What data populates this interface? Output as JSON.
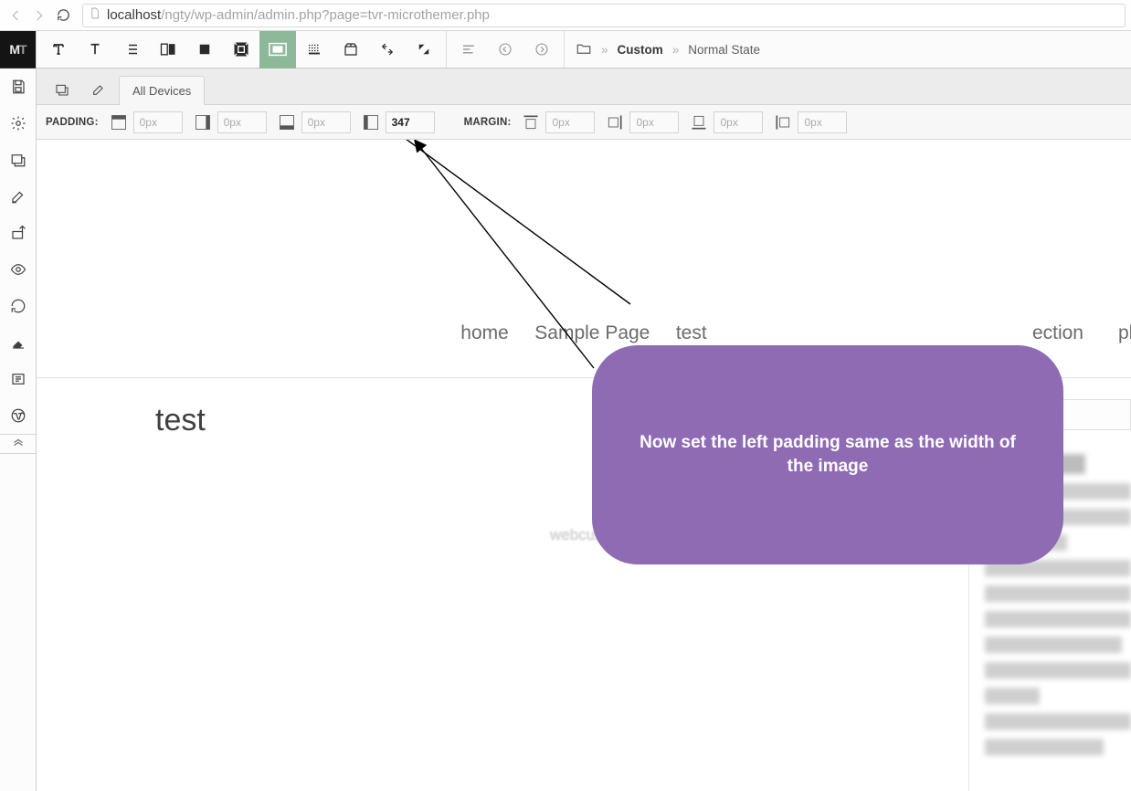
{
  "browser": {
    "url_host": "localhost",
    "url_path": "/ngty/wp-admin/admin.php?page=tvr-microthemer.php"
  },
  "logo": "MT",
  "breadcrumb": {
    "crumb1": "Custom",
    "crumb2": "Normal State"
  },
  "tabs": {
    "all_devices": "All Devices"
  },
  "spacing": {
    "padding_label": "PADDING:",
    "margin_label": "MARGIN:",
    "placeholder": "0px",
    "padding_left_value": "347"
  },
  "preview": {
    "nav": {
      "home": "home",
      "sample": "Sample Page",
      "test": "test",
      "ection": "ection",
      "phra": "phra"
    },
    "title": "test",
    "watermark": "webcusp.com"
  },
  "callout": {
    "text": "Now set the left padding same as the width of the image"
  }
}
